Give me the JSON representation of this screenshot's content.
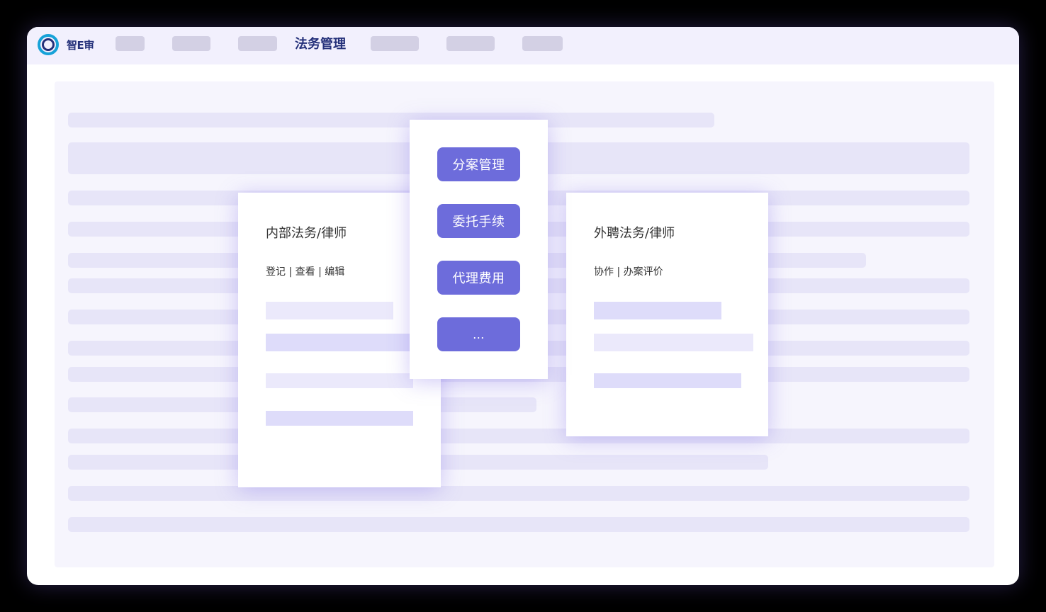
{
  "app": {
    "logo_text": "智E审",
    "active_nav": "法务管理"
  },
  "colors": {
    "accent": "#6d6cdb",
    "nav_text": "#24307a",
    "topbar_bg": "#f2f0fd",
    "content_bg": "#f6f5fd"
  },
  "icons": {
    "logo": "ring-logo-icon"
  },
  "internal_card": {
    "title": "内部法务/律师",
    "actions": "登记 | 查看 | 编辑"
  },
  "external_card": {
    "title": "外聘法务/律师",
    "actions": "协作 | 办案评价"
  },
  "menu": {
    "items": [
      "分案管理",
      "委托手续",
      "代理费用",
      "..."
    ]
  }
}
